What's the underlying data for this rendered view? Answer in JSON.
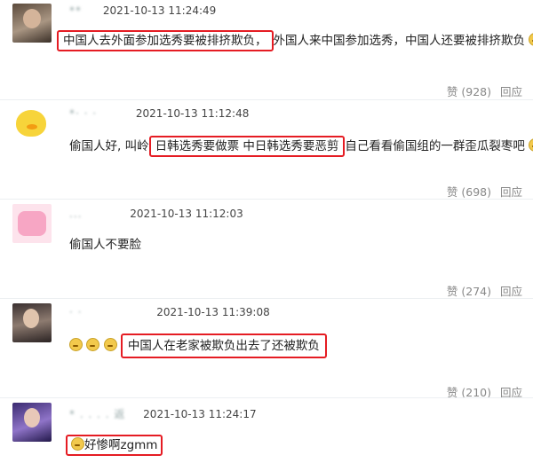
{
  "comments": [
    {
      "user": "**",
      "time": "2021-10-13 11:24:49",
      "pre": "",
      "highlight": "中国人去外面参加选秀要被排挤欺负，",
      "post": "外国人来中国参加选秀，中国人还要被排挤欺负",
      "likes_label": "赞 (928)",
      "reply_label": "回应"
    },
    {
      "user": "*·  ·  ·",
      "time": "2021-10-13 11:12:48",
      "pre": "偷国人好, 叫岭",
      "highlight": "日韩选秀要做票 中日韩选秀要恶剪",
      "post": "自己看看偷国组的一群歪瓜裂枣吧",
      "likes_label": "赞 (698)",
      "reply_label": "回应"
    },
    {
      "user": "...",
      "time": "2021-10-13 11:12:03",
      "pre": "偷国人不要脸",
      "highlight": "",
      "post": "",
      "likes_label": "赞 (274)",
      "reply_label": "回应"
    },
    {
      "user": "·  ·",
      "time": "2021-10-13 11:39:08",
      "pre": "",
      "highlight": "中国人在老家被欺负出去了还被欺负",
      "post": "",
      "likes_label": "赞 (210)",
      "reply_label": "回应"
    },
    {
      "user": "*  .  .  .  .  返",
      "time": "2021-10-13 11:24:17",
      "pre": "",
      "highlight": "好惨啊zgmm",
      "post": "",
      "likes_label": "",
      "reply_label": ""
    }
  ],
  "icons": {
    "avatar_1": "person-photo-avatar",
    "avatar_2": "yellow-duck-avatar",
    "avatar_3": "pink-sticker-avatar",
    "avatar_4": "person-photo-avatar",
    "avatar_5": "person-photo-avatar",
    "emoji": "crying-face-emoji"
  },
  "colors": {
    "highlight_border": "#e51c23"
  }
}
